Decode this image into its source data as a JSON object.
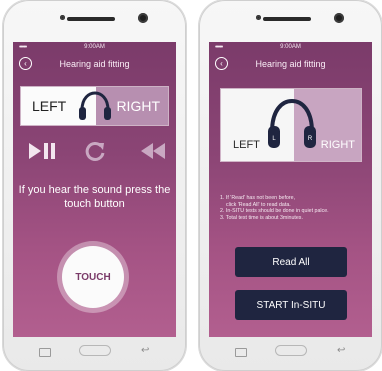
{
  "colors": {
    "screen_top": "#7b3b6a",
    "screen_bottom": "#b25f8f",
    "button_dark": "#1f2540",
    "toggle_selected": "#fbfbfb",
    "toggle_unselected": "#b78fb0"
  },
  "left_phone": {
    "status": {
      "time": "9:00AM",
      "signal": "•••••"
    },
    "appbar": {
      "back_icon": "chevron-left-icon",
      "title": "Hearing aid fitting"
    },
    "toggle": {
      "left_label": "LEFT",
      "right_label": "RIGHT",
      "selected": "LEFT",
      "icon": "headphones-icon"
    },
    "controls": [
      "play-pause-icon",
      "replay-icon",
      "rewind-icon"
    ],
    "instruction": "If you hear the sound press the touch button",
    "touch_label": "TOUCH"
  },
  "right_phone": {
    "status": {
      "time": "9:00AM",
      "signal": "•••••"
    },
    "appbar": {
      "back_icon": "chevron-left-icon",
      "title": "Hearing aid fitting"
    },
    "ear_select": {
      "left_label": "LEFT",
      "right_label": "RIGHT",
      "headphone_left_mark": "L",
      "headphone_right_mark": "R"
    },
    "notes": [
      "1. If 'Read' has not been before,",
      "click 'Read All' to read data.",
      "2. In-SITU tests should be done in quiet palce.",
      "3. Total test time is about 3minutes."
    ],
    "buttons": {
      "read_all": "Read All",
      "start_insitu": "START In-SITU"
    }
  }
}
